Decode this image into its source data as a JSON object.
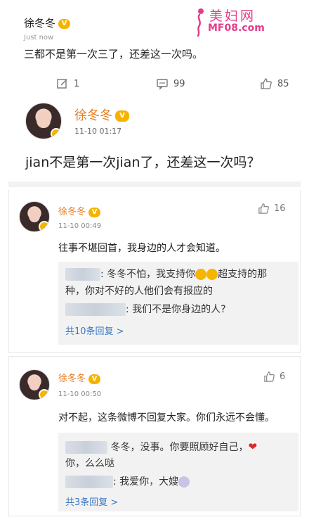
{
  "post": {
    "author": "徐冬冬",
    "time": "Just now",
    "text": "三都不是第一次三了，还差这一次吗。",
    "actions": {
      "repost": "1",
      "comment": "99",
      "like": "85"
    }
  },
  "watermark": {
    "title": "美妇网",
    "subtitle": "MF08.com"
  },
  "quote": {
    "author": "徐冬冬",
    "time": "11-10 01:17",
    "text": "jian不是第一次jian了，还差这一次吗？"
  },
  "comments": [
    {
      "author": "徐冬冬",
      "time": "11-10 00:49",
      "likes": "16",
      "text": "往事不堪回首，我身边的人才会知道。",
      "replies": [
        {
          "text_a": ": 冬冬不怕，我支持你",
          "text_b": "超支持的那",
          "text_c": "种，你对不好的人他们会有报应的"
        },
        {
          "text_a": ": 我们不是你身边的人?"
        }
      ],
      "more": "共10条回复 >"
    },
    {
      "author": "徐冬冬",
      "time": "11-10 00:50",
      "likes": "6",
      "text": "对不起，这条微博不回复大家。你们永远不会懂。",
      "replies": [
        {
          "text_a": "冬冬，没事。你要照顾好自己，",
          "text_c": "你，么么哒"
        },
        {
          "text_a": ": 我爱你，大嫂"
        }
      ],
      "more": "共3条回复 >"
    }
  ],
  "icons": {
    "vip": "vip-badge-icon",
    "repost": "edit-icon",
    "comment": "comment-icon",
    "like": "thumbs-up-icon",
    "heart": "heart-icon"
  },
  "colors": {
    "name": "#e87c1e",
    "link": "#3a78c4",
    "watermark": "#e23d8a"
  }
}
